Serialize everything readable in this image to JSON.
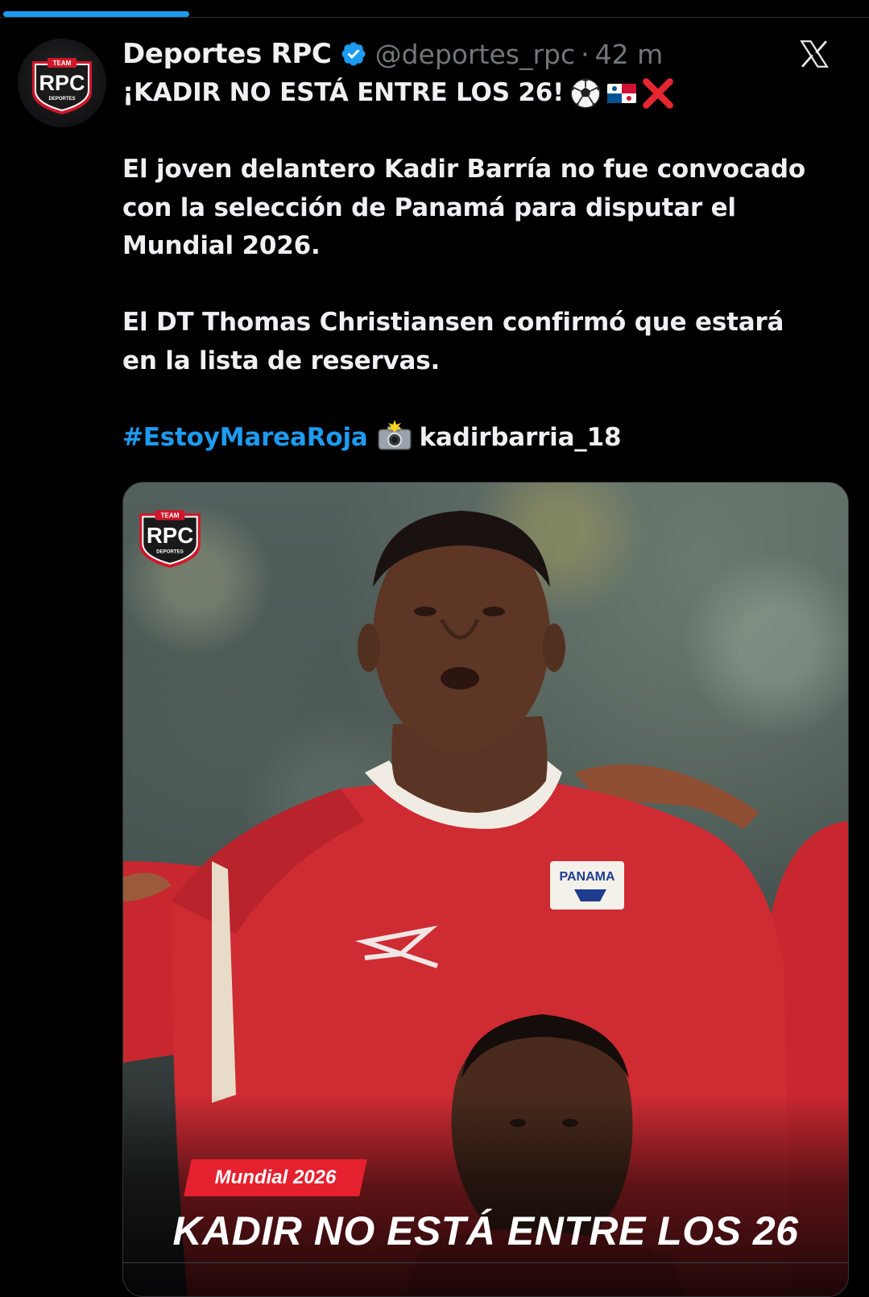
{
  "progress": {
    "fraction": 0.214
  },
  "post": {
    "author_name": "Deportes RPC",
    "verified": true,
    "handle": "@deportes_rpc",
    "separator": "·",
    "time": "42 m",
    "headline": "¡KADIR NO ESTÁ ENTRE LOS 26!",
    "paragraph_1_lines": [
      "El joven delantero Kadir Barría no fue convocado",
      "con la selección de Panamá para disputar el",
      "Mundial 2026."
    ],
    "paragraph_2_lines": [
      "El DT Thomas Christiansen confirmó que estará",
      "en la lista de reservas."
    ],
    "hashtag": "#EstoyMareaRoja",
    "photo_credit": "kadirbarria_18"
  },
  "logo": {
    "team_text": "TEAM",
    "brand_text": "RPC",
    "sub_text": "DEPORTES"
  },
  "media": {
    "jersey_text": "PANAMA",
    "tag_label": "Mundial 2026",
    "headline": "KADIR NO ESTÁ ENTRE LOS 26"
  },
  "icons": {
    "verified": "verified-badge-icon",
    "close": "x-logo-icon",
    "soccer": "soccer-ball-icon",
    "flag": "panama-flag-icon",
    "cross": "cross-mark-icon",
    "camera": "camera-flash-icon"
  },
  "colors": {
    "background": "#000000",
    "accent_blue": "#1d9bf0",
    "muted": "#71767b",
    "brand_red": "#e5212f"
  }
}
